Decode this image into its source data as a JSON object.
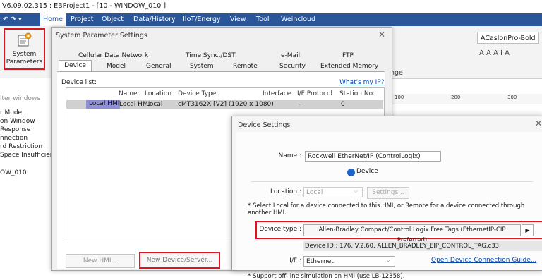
{
  "window": {
    "title": "V6.09.02.315 : EBProject1 - [10 - WINDOW_010 ]"
  },
  "quick_access": {
    "arrows": "↶ ↷ ▾"
  },
  "menu": [
    "Home",
    "Project",
    "Object",
    "Data/History",
    "IIoT/Energy",
    "View",
    "Tool",
    "Weincloud"
  ],
  "ribbon": {
    "system_parameters_line1": "System",
    "system_parameters_line2": "Parameters",
    "font_name": "ACaslonPro-Bold",
    "font_tools": "A A A  I  A",
    "range_label": "nge",
    "ruler": [
      "100",
      "200",
      "300"
    ]
  },
  "left_panel": {
    "filter": "lter windows",
    "items": [
      "r Mode",
      "on Window",
      "Response",
      "nnection",
      "rd Restriction",
      "Space Insufficier",
      "",
      "OW_010"
    ]
  },
  "system_parameter_dialog": {
    "title": "System Parameter Settings",
    "tabs_row1": [
      "Cellular Data Network",
      "Time Sync./DST",
      "e-Mail",
      "FTP"
    ],
    "tabs_row2": [
      "Device",
      "Model",
      "General",
      "System",
      "Remote",
      "Security",
      "Extended Memory"
    ],
    "device_list_label": "Device list:",
    "whats_my_ip": "What's my IP?",
    "columns": [
      "Name",
      "Location",
      "Device Type",
      "Interface",
      "I/F Protocol",
      "Station No."
    ],
    "rows": [
      {
        "label": "Local HMI",
        "name": "Local HMI",
        "location": "Local",
        "device_type": "cMT3162X [V2] (1920 x 1080)",
        "interface": "-",
        "protocol": "-",
        "station": "0"
      }
    ],
    "new_hmi": "New HMI...",
    "new_device": "New Device/Server..."
  },
  "device_settings_dialog": {
    "title": "Device Settings",
    "name_label": "Name :",
    "name_value": "Rockwell EtherNet/IP (ControlLogix)",
    "radio_device": "Device",
    "location_label": "Location :",
    "location_value": "Local",
    "settings_button": "Settings...",
    "note_local": "* Select Local for a device connected to this HMI, or Remote for a device connected through another HMI.",
    "device_type_label": "Device type :",
    "device_type_value": "Allen-Bradley Compact/Control Logix Free Tags (EthernetIP-CIP Preferred)",
    "device_id": "Device ID : 176, V.2.60, ALLEN_BRADLEY_EIP_CONTROL_TAG.c33",
    "if_label": "I/F :",
    "if_value": "Ethernet",
    "guide_link": "Open Device Connection Guide...",
    "note_offline": "* Support off-line simulation on HMI (use LB-12358)."
  },
  "colors": {
    "menubar": "#2b579a",
    "highlight_red": "#e0141e",
    "selected_cell": "#8f8fd8"
  }
}
